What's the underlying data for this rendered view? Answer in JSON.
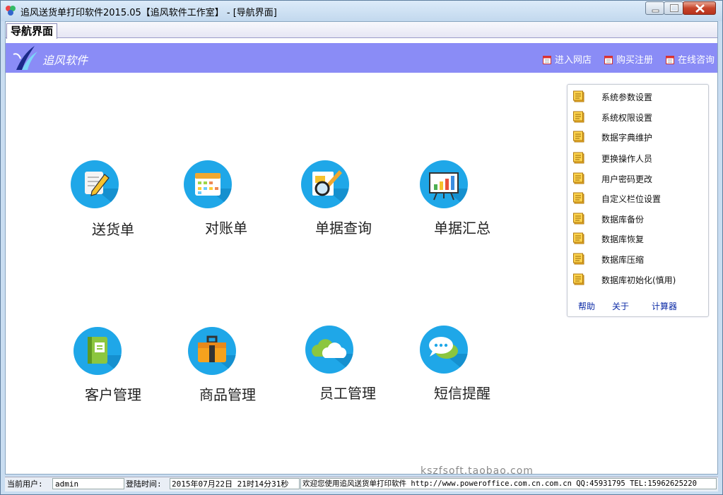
{
  "window": {
    "title": "追风送货单打印软件2015.05【追风软件工作室】 - [导航界面]"
  },
  "tabs": [
    {
      "label": "导航界面"
    }
  ],
  "banner": {
    "logo_text": "追风软件",
    "links": [
      {
        "label": "进入网店",
        "icon": "calendar-icon"
      },
      {
        "label": "购买注册",
        "icon": "calendar-icon"
      },
      {
        "label": "在线咨询",
        "icon": "calendar-icon"
      }
    ],
    "bg_color": "#8a8cf6"
  },
  "tiles": [
    {
      "label": "送货单",
      "icon": "edit-document-icon"
    },
    {
      "label": "对账单",
      "icon": "calendar-icon"
    },
    {
      "label": "单据查询",
      "icon": "search-document-icon"
    },
    {
      "label": "单据汇总",
      "icon": "presentation-chart-icon"
    },
    {
      "label": "客户管理",
      "icon": "address-book-icon"
    },
    {
      "label": "商品管理",
      "icon": "briefcase-icon"
    },
    {
      "label": "员工管理",
      "icon": "cloud-icon"
    },
    {
      "label": "短信提醒",
      "icon": "chat-bubble-icon"
    }
  ],
  "settings_panel": {
    "items": [
      "系统参数设置",
      "系统权限设置",
      "数据字典维护",
      "更换操作人员",
      "用户密码更改",
      "自定义栏位设置",
      "数据库备份",
      "数据库恢复",
      "数据库压缩",
      "数据库初始化(慎用)"
    ],
    "links": [
      "帮助",
      "关于",
      "计算器"
    ]
  },
  "statusbar": {
    "user_label": "当前用户:",
    "user_value": "admin",
    "login_label": "登陆时间:",
    "login_value": "2015年07月22日 21时14分31秒",
    "message": "欢迎您使用追风送货单打印软件 http://www.poweroffice.com.cn.com.cn QQ:45931795 TEL:15962625220"
  },
  "watermark": "kszfsoft.taobao.com",
  "colors": {
    "accent_circle": "#1fa7e8",
    "banner": "#8a8cf6"
  }
}
